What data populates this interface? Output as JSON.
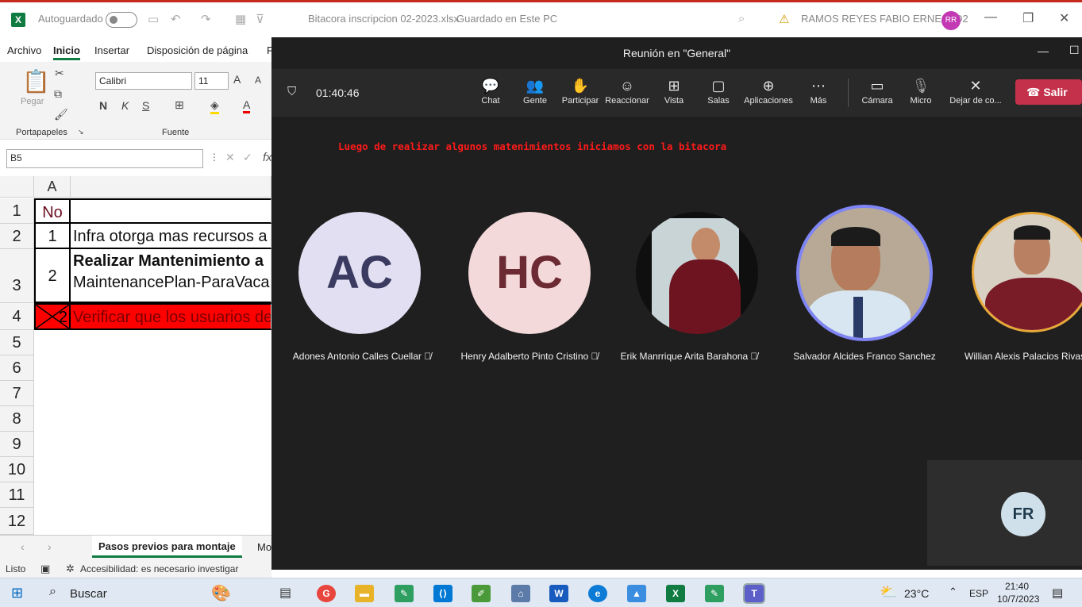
{
  "excel": {
    "app_icon": "excel-icon",
    "autosave_label": "Autoguardado",
    "file_title": "Bitacora inscripcion 02-2023.xlsx",
    "save_state": "Guardado en Este PC",
    "user_name": "RAMOS REYES FABIO ERNESTO2",
    "user_initials": "RR",
    "tabs": [
      "Archivo",
      "Inicio",
      "Insertar",
      "Disposición de página",
      "F"
    ],
    "ribbon": {
      "paste_label": "Pegar",
      "clipboard_group": "Portapapeles",
      "font_group": "Fuente",
      "font_name": "Calibri",
      "font_size": "11",
      "bold": "N",
      "italic": "K",
      "underline": "S",
      "grow": "A",
      "shrink": "A",
      "font_color": "A"
    },
    "name_box": "B5",
    "fx": "fx",
    "column_a": "A",
    "rows": [
      "1",
      "2",
      "3",
      "4",
      "5",
      "6",
      "7",
      "8",
      "9",
      "10",
      "11",
      "12"
    ],
    "cells": {
      "a1": "No",
      "a2": "1",
      "b2": "Infra otorga mas recursos a",
      "a3": "2",
      "b3_line1": "Realizar Mantenimiento a",
      "b3_line2": "MaintenancePlan-ParaVaca",
      "a4": "2",
      "b4": "Verificar que los usuarios de"
    },
    "sheet_tab": "Pasos previos para montaje",
    "sheet_tab2": "Mo",
    "status_ready": "Listo",
    "accessibility": "Accesibilidad: es necesario investigar"
  },
  "teams": {
    "title": "Reunión en \"General\"",
    "timer": "01:40:46",
    "controls": [
      {
        "label": "Chat",
        "icon": "chat-icon",
        "glyph": "💬"
      },
      {
        "label": "Gente",
        "icon": "people-icon",
        "glyph": "👥"
      },
      {
        "label": "Participar",
        "icon": "raise-hand-icon",
        "glyph": "✋"
      },
      {
        "label": "Reaccionar",
        "icon": "react-icon",
        "glyph": "☺"
      },
      {
        "label": "Vista",
        "icon": "view-icon",
        "glyph": "⊞"
      },
      {
        "label": "Salas",
        "icon": "rooms-icon",
        "glyph": "▢"
      },
      {
        "label": "Aplicaciones",
        "icon": "apps-icon",
        "glyph": "⊕"
      },
      {
        "label": "Más",
        "icon": "more-icon",
        "glyph": "⋯"
      },
      {
        "label": "Cámara",
        "icon": "camera-off-icon",
        "glyph": "▭"
      },
      {
        "label": "Micro",
        "icon": "mic-off-icon",
        "glyph": "🎙"
      },
      {
        "label": "Dejar de co...",
        "icon": "stop-share-icon",
        "glyph": "✕"
      }
    ],
    "leave_label": "Salir",
    "caption": "Luego de realizar algunos matenimientos iniciamos con la bitacora",
    "participants": [
      {
        "initials": "AC",
        "name": "Adones Antonio Calles Cuellar",
        "muted": true,
        "bg": "#e1dff1",
        "fg": "#3b3a61"
      },
      {
        "initials": "HC",
        "name": "Henry Adalberto Pinto Cristino",
        "muted": true,
        "bg": "#f4d9da",
        "fg": "#6c2a33"
      },
      {
        "initials": "",
        "name": "Erik Manrrique Arita Barahona",
        "muted": true,
        "bg": "#5a1a22",
        "fg": "#fff"
      },
      {
        "initials": "",
        "name": "Salvador Alcides Franco Sanchez",
        "muted": false,
        "bg": "#8a9aa8",
        "fg": "#fff"
      },
      {
        "initials": "",
        "name": "Willian Alexis Palacios Rivas",
        "muted": false,
        "bg": "#7a2a30",
        "fg": "#fff"
      }
    ],
    "self_initials": "FR"
  },
  "taskbar": {
    "search_label": "Buscar",
    "weather": "23°C",
    "language": "ESP",
    "time": "21:40",
    "date": "10/7/2023"
  }
}
